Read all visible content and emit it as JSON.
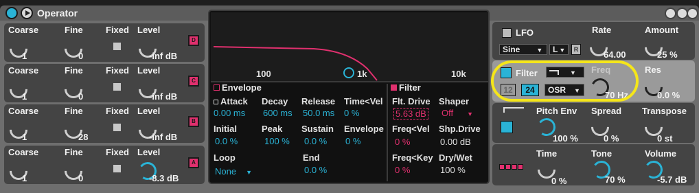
{
  "title": "Operator",
  "oscillators": [
    {
      "coarse_label": "Coarse",
      "fine_label": "Fine",
      "fixed_label": "Fixed",
      "level_label": "Level",
      "coarse": "1",
      "fine": "0",
      "level": "-inf dB",
      "osc_letter": "D"
    },
    {
      "coarse_label": "Coarse",
      "fine_label": "Fine",
      "fixed_label": "Fixed",
      "level_label": "Level",
      "coarse": "1",
      "fine": "0",
      "level": "-inf dB",
      "osc_letter": "C"
    },
    {
      "coarse_label": "Coarse",
      "fine_label": "Fine",
      "fixed_label": "Fixed",
      "level_label": "Level",
      "coarse": "1",
      "fine": "28",
      "level": "-inf dB",
      "osc_letter": "B"
    },
    {
      "coarse_label": "Coarse",
      "fine_label": "Fine",
      "fixed_label": "Fixed",
      "level_label": "Level",
      "coarse": "1",
      "fine": "0",
      "level": "-8.3 dB",
      "osc_letter": "A"
    }
  ],
  "graph": {
    "ticks": [
      "100",
      "1k",
      "10k"
    ]
  },
  "envelope": {
    "title": "Envelope",
    "attack_label": "Attack",
    "attack": "0.00 ms",
    "decay_label": "Decay",
    "decay": "600 ms",
    "release_label": "Release",
    "release": "50.0 ms",
    "timevel_label": "Time<Vel",
    "timevel": "0 %",
    "initial_label": "Initial",
    "initial": "0.0 %",
    "peak_label": "Peak",
    "peak": "100 %",
    "sustain_label": "Sustain",
    "sustain": "0.0 %",
    "envelope_label": "Envelope",
    "envelope": "0 %",
    "loop_label": "Loop",
    "loop": "None",
    "end_label": "End",
    "end": "0.0 %"
  },
  "filter_section": {
    "title": "Filter",
    "drive_label": "Flt. Drive",
    "drive": "5.63 dB",
    "shaper_label": "Shaper",
    "shaper": "Off",
    "freqvel_label": "Freq<Vel",
    "freqvel": "0 %",
    "shpdrive_label": "Shp.Drive",
    "shpdrive": "0.00 dB",
    "freqkey_label": "Freq<Key",
    "freqkey": "0 %",
    "drywet_label": "Dry/Wet",
    "drywet": "100 %"
  },
  "lfo": {
    "label": "LFO",
    "waveform": "Sine",
    "channel": "L",
    "retrigger": "R",
    "rate_label": "Rate",
    "rate": "64.00",
    "amount_label": "Amount",
    "amount": "25 %"
  },
  "filter": {
    "label": "Filter",
    "slope_12": "12",
    "slope_24": "24",
    "mode": "OSR",
    "freq_label": "Freq",
    "freq": "70 Hz",
    "res_label": "Res",
    "res": "0.0 %"
  },
  "pitch": {
    "pitch_env_label": "Pitch Env",
    "pitch_env": "100 %",
    "spread_label": "Spread",
    "spread": "0 %",
    "transpose_label": "Transpose",
    "transpose": "0 st"
  },
  "global": {
    "time_label": "Time",
    "time": "0 %",
    "tone_label": "Tone",
    "tone": "70 %",
    "volume_label": "Volume",
    "volume": "-5.7 dB"
  },
  "colors": {
    "accent_blue": "#2ab3d6",
    "accent_pink": "#e0306e",
    "highlight_yellow": "#f5e61a"
  }
}
